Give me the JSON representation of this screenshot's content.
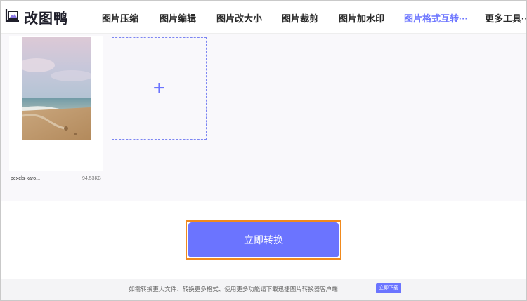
{
  "header": {
    "brand": "改图鸭",
    "nav": [
      {
        "label": "图片压缩"
      },
      {
        "label": "图片编辑"
      },
      {
        "label": "图片改大小"
      },
      {
        "label": "图片裁剪"
      },
      {
        "label": "图片加水印"
      },
      {
        "label": "图片格式互转···",
        "active": true
      },
      {
        "label": "更多工具···"
      }
    ]
  },
  "upload": {
    "files": [
      {
        "name": "pexels-karo...",
        "size": "94.53KB"
      }
    ],
    "add_symbol": "+"
  },
  "convert_button": "立即转换",
  "footer": {
    "text": "· 如需转换更大文件、转换更多格式、使用更多功能请下载迅捷图片转换器客户端",
    "download_label": "立即下载"
  },
  "colors": {
    "accent": "#6b74ff",
    "highlight_border": "#f08a1e"
  }
}
